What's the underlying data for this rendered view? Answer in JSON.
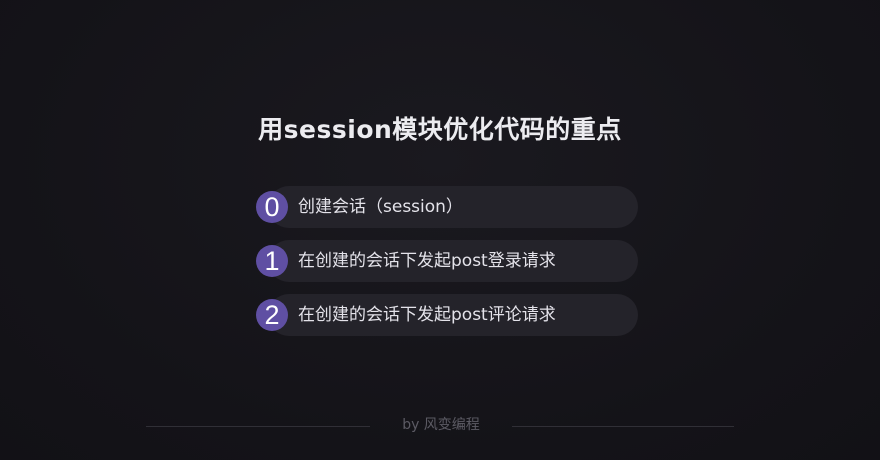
{
  "slide": {
    "title": "用session模块优化代码的重点",
    "steps": [
      {
        "number": "0",
        "text": "创建会话（session）"
      },
      {
        "number": "1",
        "text": "在创建的会话下发起post登录请求"
      },
      {
        "number": "2",
        "text": "在创建的会话下发起post评论请求"
      }
    ],
    "footer": "by 风变编程"
  },
  "colors": {
    "background": "#151419",
    "pill": "#24232a",
    "badge": "#5f4fa3",
    "title_text": "#ececf0",
    "footer_text": "#5c5b64"
  }
}
